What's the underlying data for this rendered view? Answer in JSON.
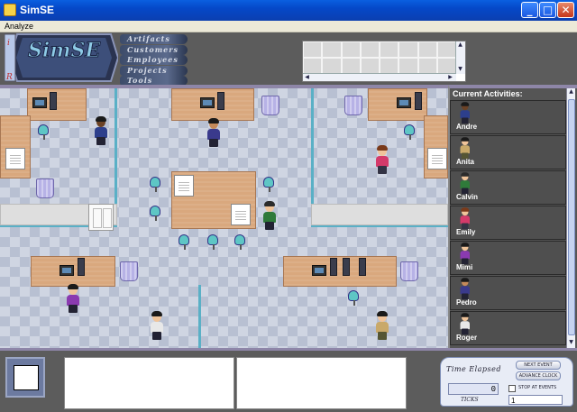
{
  "window": {
    "title": "SimSE",
    "minimize_label": "_",
    "maximize_label": "□",
    "close_label": "✕"
  },
  "menu": {
    "items": [
      "Analyze"
    ]
  },
  "nav": {
    "items": [
      "Artifacts",
      "Customers",
      "Employees",
      "Projects",
      "Tools"
    ]
  },
  "logo": {
    "text": "SimSE"
  },
  "sidebar": {
    "title": "Current Activities:",
    "employees": [
      {
        "name": "Andre",
        "skin": "#6b4226",
        "hair": "#1a1a1a",
        "shirt": "#2d3f8c"
      },
      {
        "name": "Anita",
        "skin": "#f0c49a",
        "hair": "#4a2a12",
        "shirt": "#4b7a2b"
      },
      {
        "name": "Calvin",
        "skin": "#f0c49a",
        "hair": "#2b2b2b",
        "shirt": "#2f7a3a"
      },
      {
        "name": "Emily",
        "skin": "#f0c49a",
        "hair": "#7a3a1a",
        "shirt": "#d43a6a"
      },
      {
        "name": "Mimi",
        "skin": "#f0c49a",
        "hair": "#1a1a1a",
        "shirt": "#8a3ab0"
      },
      {
        "name": "Pedro",
        "skin": "#c48a5a",
        "hair": "#1a1a1a",
        "shirt": "#3a3a8c"
      },
      {
        "name": "Roger",
        "skin": "#f0c49a",
        "hair": "#1a1a1a",
        "shirt": "#e8e8e8"
      }
    ]
  },
  "clock": {
    "title": "Time Elapsed",
    "ticks_label": "TICKS",
    "ticks_value": "0",
    "next_event_label": "NEXT EVENT",
    "advance_clock_label": "ADVANCE CLOCK",
    "stop_at_events_label": "STOP AT EVENTS",
    "step_value": "1"
  }
}
